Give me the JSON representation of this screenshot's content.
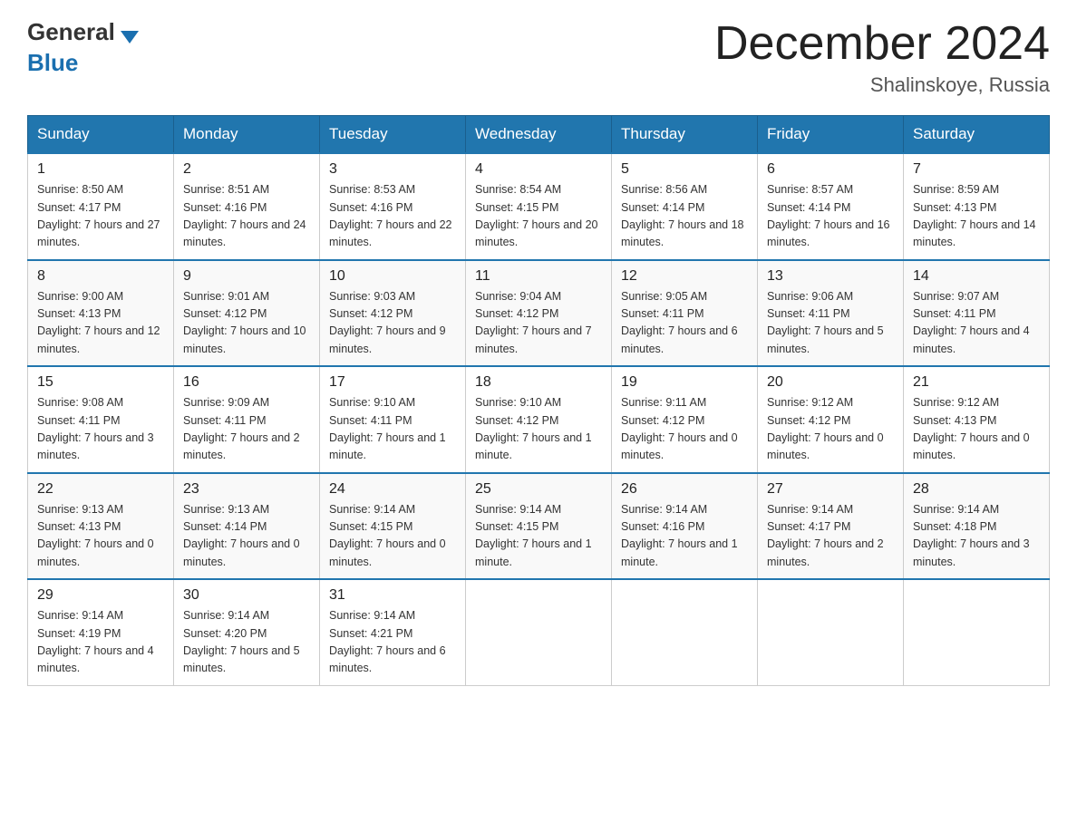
{
  "header": {
    "logo": {
      "text_general": "General",
      "text_blue": "Blue",
      "arrow_color": "#1a6faf"
    },
    "title": "December 2024",
    "location": "Shalinskoye, Russia"
  },
  "calendar": {
    "days_of_week": [
      "Sunday",
      "Monday",
      "Tuesday",
      "Wednesday",
      "Thursday",
      "Friday",
      "Saturday"
    ],
    "weeks": [
      [
        {
          "date": "1",
          "sunrise": "8:50 AM",
          "sunset": "4:17 PM",
          "daylight": "7 hours and 27 minutes."
        },
        {
          "date": "2",
          "sunrise": "8:51 AM",
          "sunset": "4:16 PM",
          "daylight": "7 hours and 24 minutes."
        },
        {
          "date": "3",
          "sunrise": "8:53 AM",
          "sunset": "4:16 PM",
          "daylight": "7 hours and 22 minutes."
        },
        {
          "date": "4",
          "sunrise": "8:54 AM",
          "sunset": "4:15 PM",
          "daylight": "7 hours and 20 minutes."
        },
        {
          "date": "5",
          "sunrise": "8:56 AM",
          "sunset": "4:14 PM",
          "daylight": "7 hours and 18 minutes."
        },
        {
          "date": "6",
          "sunrise": "8:57 AM",
          "sunset": "4:14 PM",
          "daylight": "7 hours and 16 minutes."
        },
        {
          "date": "7",
          "sunrise": "8:59 AM",
          "sunset": "4:13 PM",
          "daylight": "7 hours and 14 minutes."
        }
      ],
      [
        {
          "date": "8",
          "sunrise": "9:00 AM",
          "sunset": "4:13 PM",
          "daylight": "7 hours and 12 minutes."
        },
        {
          "date": "9",
          "sunrise": "9:01 AM",
          "sunset": "4:12 PM",
          "daylight": "7 hours and 10 minutes."
        },
        {
          "date": "10",
          "sunrise": "9:03 AM",
          "sunset": "4:12 PM",
          "daylight": "7 hours and 9 minutes."
        },
        {
          "date": "11",
          "sunrise": "9:04 AM",
          "sunset": "4:12 PM",
          "daylight": "7 hours and 7 minutes."
        },
        {
          "date": "12",
          "sunrise": "9:05 AM",
          "sunset": "4:11 PM",
          "daylight": "7 hours and 6 minutes."
        },
        {
          "date": "13",
          "sunrise": "9:06 AM",
          "sunset": "4:11 PM",
          "daylight": "7 hours and 5 minutes."
        },
        {
          "date": "14",
          "sunrise": "9:07 AM",
          "sunset": "4:11 PM",
          "daylight": "7 hours and 4 minutes."
        }
      ],
      [
        {
          "date": "15",
          "sunrise": "9:08 AM",
          "sunset": "4:11 PM",
          "daylight": "7 hours and 3 minutes."
        },
        {
          "date": "16",
          "sunrise": "9:09 AM",
          "sunset": "4:11 PM",
          "daylight": "7 hours and 2 minutes."
        },
        {
          "date": "17",
          "sunrise": "9:10 AM",
          "sunset": "4:11 PM",
          "daylight": "7 hours and 1 minute."
        },
        {
          "date": "18",
          "sunrise": "9:10 AM",
          "sunset": "4:12 PM",
          "daylight": "7 hours and 1 minute."
        },
        {
          "date": "19",
          "sunrise": "9:11 AM",
          "sunset": "4:12 PM",
          "daylight": "7 hours and 0 minutes."
        },
        {
          "date": "20",
          "sunrise": "9:12 AM",
          "sunset": "4:12 PM",
          "daylight": "7 hours and 0 minutes."
        },
        {
          "date": "21",
          "sunrise": "9:12 AM",
          "sunset": "4:13 PM",
          "daylight": "7 hours and 0 minutes."
        }
      ],
      [
        {
          "date": "22",
          "sunrise": "9:13 AM",
          "sunset": "4:13 PM",
          "daylight": "7 hours and 0 minutes."
        },
        {
          "date": "23",
          "sunrise": "9:13 AM",
          "sunset": "4:14 PM",
          "daylight": "7 hours and 0 minutes."
        },
        {
          "date": "24",
          "sunrise": "9:14 AM",
          "sunset": "4:15 PM",
          "daylight": "7 hours and 0 minutes."
        },
        {
          "date": "25",
          "sunrise": "9:14 AM",
          "sunset": "4:15 PM",
          "daylight": "7 hours and 1 minute."
        },
        {
          "date": "26",
          "sunrise": "9:14 AM",
          "sunset": "4:16 PM",
          "daylight": "7 hours and 1 minute."
        },
        {
          "date": "27",
          "sunrise": "9:14 AM",
          "sunset": "4:17 PM",
          "daylight": "7 hours and 2 minutes."
        },
        {
          "date": "28",
          "sunrise": "9:14 AM",
          "sunset": "4:18 PM",
          "daylight": "7 hours and 3 minutes."
        }
      ],
      [
        {
          "date": "29",
          "sunrise": "9:14 AM",
          "sunset": "4:19 PM",
          "daylight": "7 hours and 4 minutes."
        },
        {
          "date": "30",
          "sunrise": "9:14 AM",
          "sunset": "4:20 PM",
          "daylight": "7 hours and 5 minutes."
        },
        {
          "date": "31",
          "sunrise": "9:14 AM",
          "sunset": "4:21 PM",
          "daylight": "7 hours and 6 minutes."
        },
        null,
        null,
        null,
        null
      ]
    ]
  }
}
